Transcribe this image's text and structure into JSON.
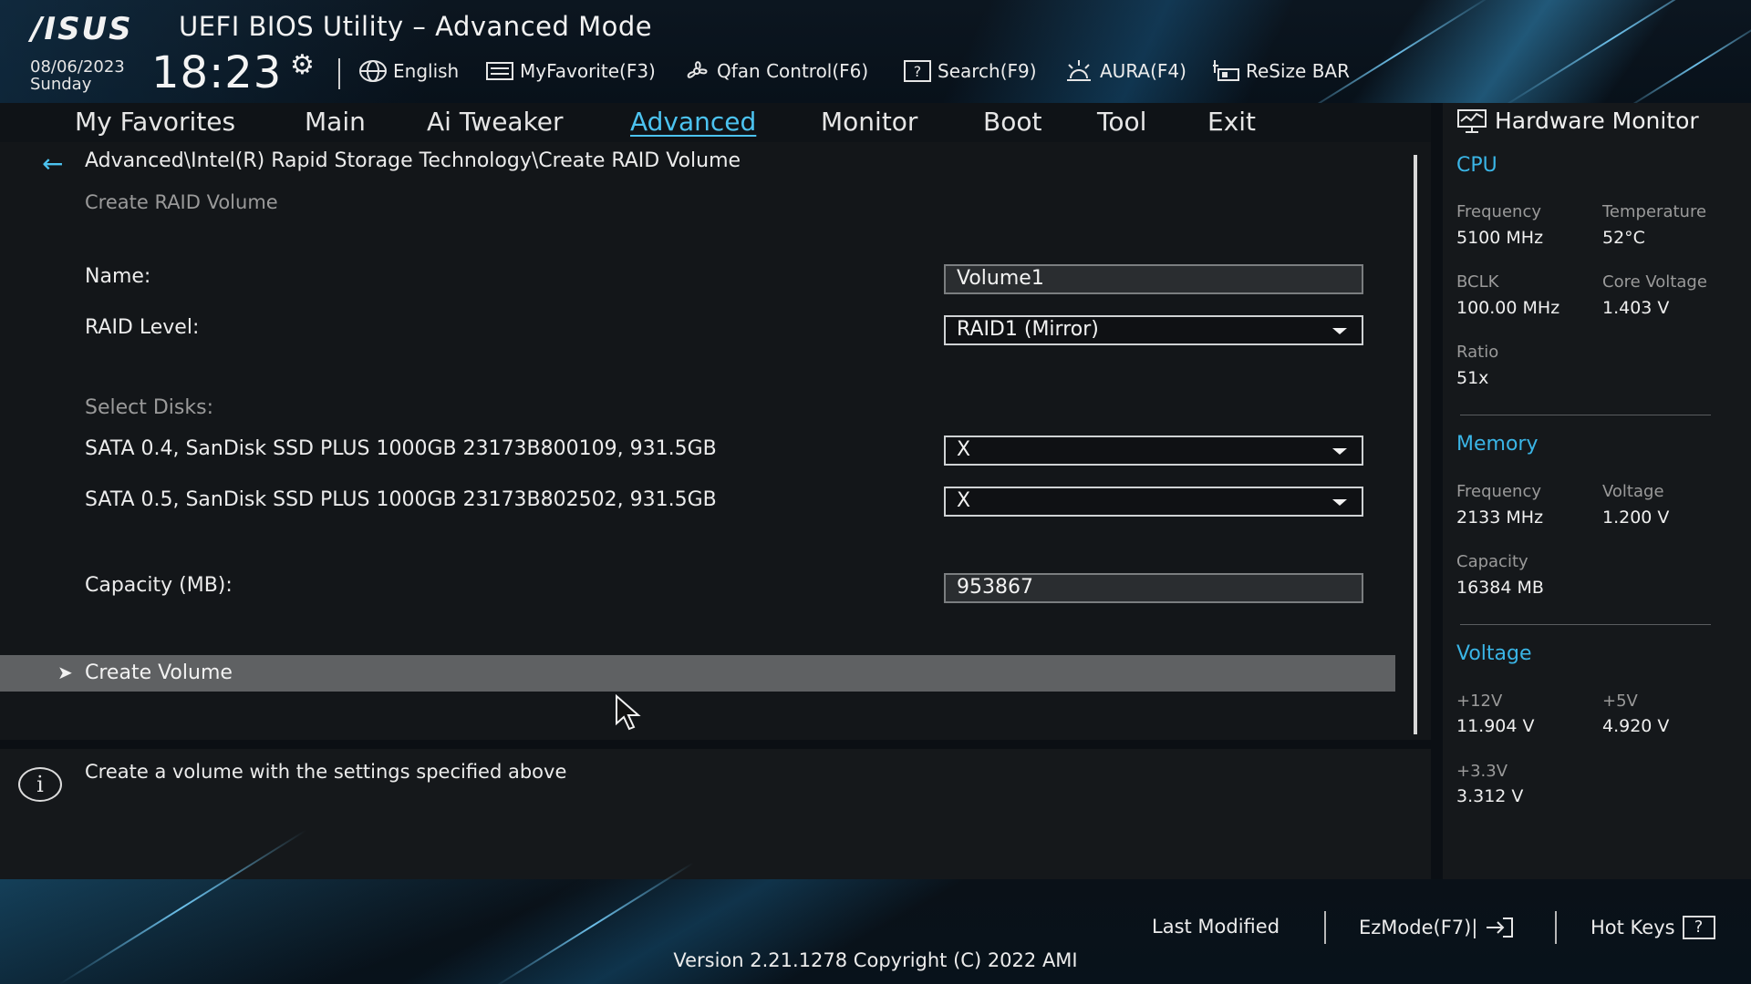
{
  "header": {
    "logo": "/ISUS",
    "title": "UEFI BIOS Utility – Advanced Mode",
    "date": "08/06/2023",
    "day": "Sunday",
    "time": "18:23",
    "toolbar": {
      "language": "English",
      "my_favorite": "MyFavorite(F3)",
      "qfan": "Qfan Control(F6)",
      "search": "Search(F9)",
      "aura": "AURA(F4)",
      "resize_bar": "ReSize BAR"
    }
  },
  "nav": {
    "tabs": [
      {
        "label": "My Favorites"
      },
      {
        "label": "Main"
      },
      {
        "label": "Ai Tweaker"
      },
      {
        "label": "Advanced",
        "active": true
      },
      {
        "label": "Monitor"
      },
      {
        "label": "Boot"
      },
      {
        "label": "Tool"
      },
      {
        "label": "Exit"
      }
    ]
  },
  "main": {
    "breadcrumb": "Advanced\\Intel(R) Rapid Storage Technology\\Create RAID Volume",
    "section_title": "Create RAID Volume",
    "name_label": "Name:",
    "name_value": "Volume1",
    "raid_level_label": "RAID Level:",
    "raid_level_value": "RAID1 (Mirror)",
    "select_disks_label": "Select Disks:",
    "disks": [
      {
        "label": "SATA 0.4, SanDisk SSD PLUS 1000GB 23173B800109, 931.5GB",
        "value": "X"
      },
      {
        "label": "SATA 0.5, SanDisk SSD PLUS 1000GB 23173B802502, 931.5GB",
        "value": "X"
      }
    ],
    "capacity_label": "Capacity (MB):",
    "capacity_value": "953867",
    "create_volume_label": "Create Volume"
  },
  "help": {
    "text": "Create a volume with the settings specified above"
  },
  "hardware_monitor": {
    "title": "Hardware Monitor",
    "cpu": {
      "heading": "CPU",
      "frequency_label": "Frequency",
      "frequency_value": "5100 MHz",
      "temperature_label": "Temperature",
      "temperature_value": "52°C",
      "bclk_label": "BCLK",
      "bclk_value": "100.00 MHz",
      "core_voltage_label": "Core Voltage",
      "core_voltage_value": "1.403 V",
      "ratio_label": "Ratio",
      "ratio_value": "51x"
    },
    "memory": {
      "heading": "Memory",
      "frequency_label": "Frequency",
      "frequency_value": "2133 MHz",
      "voltage_label": "Voltage",
      "voltage_value": "1.200 V",
      "capacity_label": "Capacity",
      "capacity_value": "16384 MB"
    },
    "voltage": {
      "heading": "Voltage",
      "v12_label": "+12V",
      "v12_value": "11.904 V",
      "v5_label": "+5V",
      "v5_value": "4.920 V",
      "v33_label": "+3.3V",
      "v33_value": "3.312 V"
    }
  },
  "footer": {
    "last_modified": "Last Modified",
    "ezmode": "EzMode(F7)|",
    "hot_keys": "Hot Keys",
    "hot_keys_glyph": "?",
    "version": "Version 2.21.1278 Copyright (C) 2022 AMI"
  },
  "colors": {
    "accent": "#4cc3f0",
    "section_heading": "#3ab5e6",
    "highlight_row": "#5f6163"
  }
}
